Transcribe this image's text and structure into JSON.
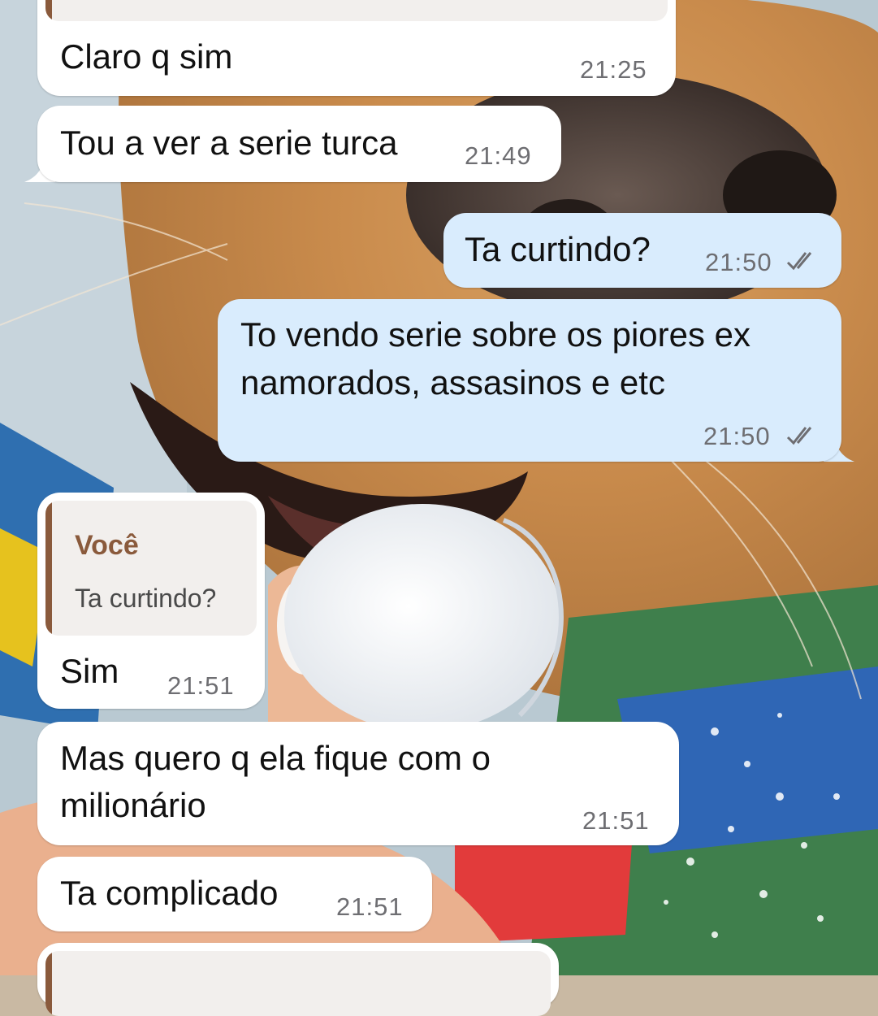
{
  "messages": [
    {
      "id": "m1",
      "direction": "incoming",
      "text": "Claro q sim",
      "time": "21:25"
    },
    {
      "id": "m2",
      "direction": "incoming",
      "text": "Tou a ver a serie turca",
      "time": "21:49"
    },
    {
      "id": "m3",
      "direction": "outgoing",
      "text": "Ta curtindo?",
      "time": "21:50",
      "status": "read-ticks-icon"
    },
    {
      "id": "m4",
      "direction": "outgoing",
      "lines": [
        "To vendo serie sobre os piores ex",
        "namorados, assasinos e etc"
      ],
      "time": "21:50",
      "status": "read-ticks-icon"
    },
    {
      "id": "m5",
      "direction": "incoming",
      "reply_to": {
        "author": "Você",
        "text": "Ta curtindo?"
      },
      "text": "Sim",
      "time": "21:51"
    },
    {
      "id": "m6",
      "direction": "incoming",
      "lines": [
        "Mas quero q ela fique com o",
        "milionário"
      ],
      "time": "21:51"
    },
    {
      "id": "m7",
      "direction": "incoming",
      "text": "Ta complicado",
      "time": "21:51"
    }
  ],
  "colors": {
    "incoming_bubble": "#ffffff",
    "outgoing_bubble": "#d9ecfd",
    "quote_accent": "#8a5a3c",
    "timestamp": "#6e6e72"
  },
  "wallpaper": "dog-licking-ice-photo"
}
